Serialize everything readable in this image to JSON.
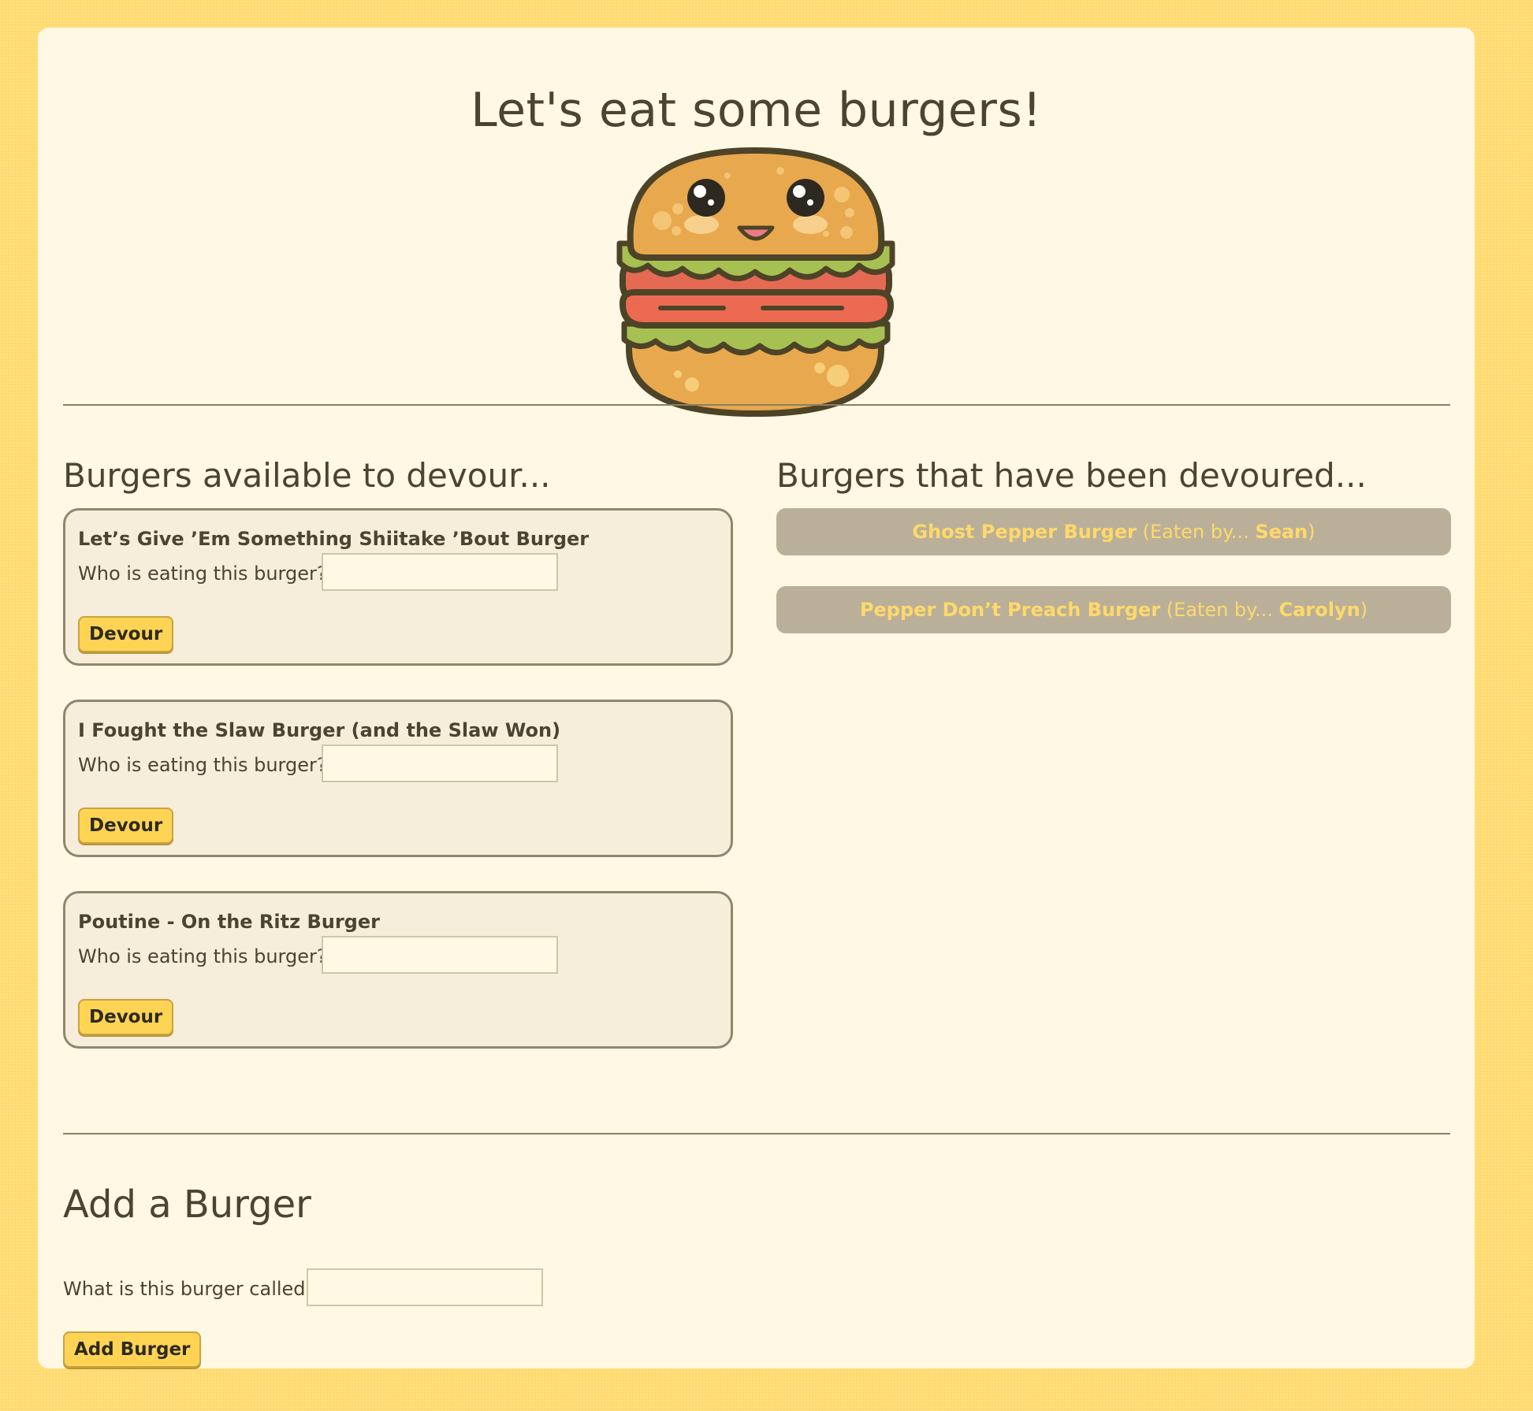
{
  "header": {
    "title": "Let's eat some burgers!",
    "mascot_icon": "burger-mascot-icon"
  },
  "available": {
    "heading": "Burgers available to devour...",
    "items": [
      {
        "name": "Let’s Give ’Em Something Shiitake ’Bout Burger",
        "eater_label": "Who is eating this burger?",
        "eater_value": "",
        "button_label": "Devour"
      },
      {
        "name": "I Fought the Slaw Burger (and the Slaw Won)",
        "eater_label": "Who is eating this burger?",
        "eater_value": "",
        "button_label": "Devour"
      },
      {
        "name": "Poutine - On the Ritz Burger",
        "eater_label": "Who is eating this burger?",
        "eater_value": "",
        "button_label": "Devour"
      }
    ]
  },
  "devoured": {
    "heading": "Burgers that have been devoured...",
    "eaten_by_label": "(Eaten by...",
    "closing": ")",
    "items": [
      {
        "name": "Ghost Pepper Burger",
        "eater": "Sean"
      },
      {
        "name": "Pepper Don’t Preach Burger",
        "eater": "Carolyn"
      }
    ]
  },
  "add_form": {
    "heading": "Add a Burger",
    "name_label": "What is this burger called?",
    "name_value": "",
    "button_label": "Add Burger"
  },
  "colors": {
    "page_background": "#ffd96a",
    "card_background": "#fff8e4",
    "text": "#4a4430",
    "button": "#ffd455",
    "eaten_background": "#bab099",
    "eaten_text": "#ffd96a"
  }
}
